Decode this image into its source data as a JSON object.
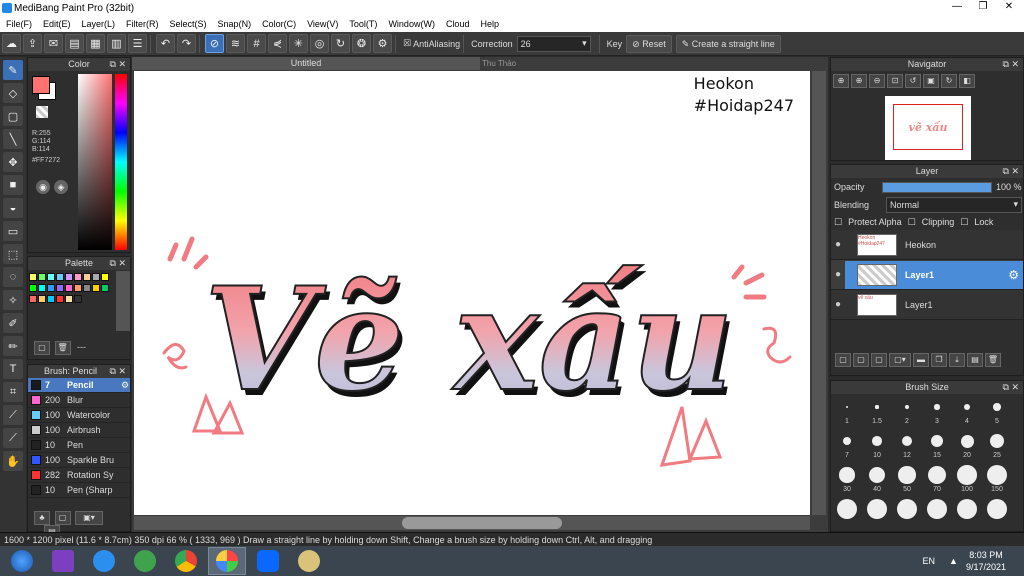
{
  "window": {
    "title": "MediBang Paint Pro (32bit)",
    "btn_min": "—",
    "btn_max": "❐",
    "btn_close": "✕"
  },
  "menu": [
    "File(F)",
    "Edit(E)",
    "Layer(L)",
    "Filter(R)",
    "Select(S)",
    "Snap(N)",
    "Color(C)",
    "View(V)",
    "Tool(T)",
    "Window(W)",
    "Cloud",
    "Help"
  ],
  "toolbar": {
    "antialias_label": "AntiAliasing",
    "antialias_check": "☒",
    "correction_label": "Correction",
    "correction_value": "26",
    "key_label": "Key",
    "reset_label": "Reset",
    "straight_line_label": "Create a straight line"
  },
  "color_panel": {
    "title": "Color",
    "r": "R:255",
    "g": "G:114",
    "b": "B:114",
    "hex": "#FF7272",
    "fg": "#ff7272",
    "bg": "#ffffff"
  },
  "palette_panel": {
    "title": "Palette",
    "page_label": "---",
    "swatches": [
      "#ffff66",
      "#66ff66",
      "#66ffff",
      "#66ccff",
      "#cc99ff",
      "#ff99cc",
      "#ffcc99",
      "#aaaaaa",
      "#ffff00",
      "#00ff00",
      "#00ffff",
      "#3399ff",
      "#9966ff",
      "#ff66cc",
      "#ff9966",
      "#888888",
      "#ffcc00",
      "#00cc66",
      "#ff6666",
      "#ffcc66",
      "#00ccff",
      "#ff3333",
      "#ffddaa",
      "#333333"
    ]
  },
  "brush_panel": {
    "title": "Brush: Pencil",
    "items": [
      {
        "size": "7",
        "name": "Pencil",
        "color": "#1a1a1a"
      },
      {
        "size": "200",
        "name": "Blur",
        "color": "#ff66cc"
      },
      {
        "size": "100",
        "name": "Watercolor",
        "color": "#66ccff"
      },
      {
        "size": "100",
        "name": "Airbrush",
        "color": "#cccccc"
      },
      {
        "size": "10",
        "name": "Pen",
        "color": "#222222"
      },
      {
        "size": "100",
        "name": "Sparkle Bru",
        "color": "#3355ff"
      },
      {
        "size": "282",
        "name": "Rotation Sy",
        "color": "#ff3333"
      },
      {
        "size": "10",
        "name": "Pen (Sharp",
        "color": "#222222"
      }
    ]
  },
  "document": {
    "tab": "Untitled",
    "tab2": "Thu Thảo",
    "watermark1": "Heokon",
    "watermark2": "#Hoidap247",
    "artwork_text": "Vẽ xấu"
  },
  "navigator": {
    "title": "Navigator",
    "thumb_text": "vẽ xấu"
  },
  "layer_panel": {
    "title": "Layer",
    "opacity_label": "Opacity",
    "opacity_value": "100 %",
    "opacity": 1.0,
    "blending_label": "Blending",
    "blending_value": "Normal",
    "protect_alpha": "Protect Alpha",
    "clipping": "Clipping",
    "lock": "Lock",
    "layers": [
      {
        "name": "Heokon",
        "thumb": "Heokon #Hoidap247"
      },
      {
        "name": "Layer1",
        "thumb": ""
      },
      {
        "name": "Layer1",
        "thumb": "vẽ xấu"
      }
    ]
  },
  "brush_size_panel": {
    "title": "Brush Size",
    "sizes": [
      "1",
      "1.5",
      "2",
      "3",
      "4",
      "5",
      "7",
      "10",
      "12",
      "15",
      "20",
      "25",
      "30",
      "40",
      "50",
      "70",
      "100",
      "150",
      "",
      "",
      "",
      "",
      "",
      ""
    ]
  },
  "status": {
    "text": "1600 * 1200 pixel  (11.6 * 8.7cm)  350 dpi  66 %  ( 1333, 969 )  Draw a straight line by holding down Shift, Change a brush size by holding down Ctrl, Alt, and dragging"
  },
  "taskbar": {
    "lang": "EN",
    "time": "8:03 PM",
    "date": "9/17/2021"
  }
}
